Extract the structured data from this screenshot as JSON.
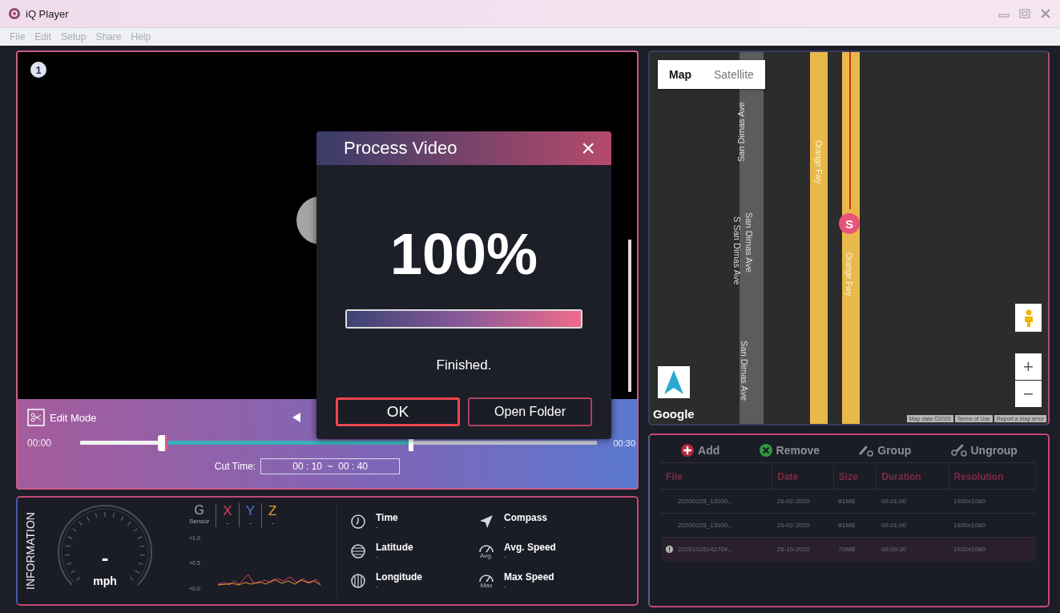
{
  "window": {
    "title": "iQ Player"
  },
  "menu": [
    {
      "label": "File",
      "disabled": true
    },
    {
      "label": "Edit",
      "disabled": true
    },
    {
      "label": "Setup",
      "disabled": true
    },
    {
      "label": "Share",
      "disabled": true
    },
    {
      "label": "Help",
      "disabled": true
    }
  ],
  "video": {
    "channel_badge": "1",
    "edit_mode": "Edit Mode",
    "start_time": "00:00",
    "end_time": "00:30",
    "playhead": {
      "level": 0.16
    },
    "cut_end": {
      "level": 0.64
    },
    "cut_time_label": "Cut Time:",
    "cut_time": "00 : 10  ~  00 : 40"
  },
  "dialog": {
    "title": "Process Video",
    "close": "×",
    "percent": "100%",
    "progress": {
      "level": 1.0
    },
    "status": "Finished.",
    "buttons": [
      {
        "label": "OK",
        "selected": true
      },
      {
        "label": "Open Folder",
        "selected": false
      }
    ]
  },
  "map": {
    "tabs": [
      {
        "label": "Map",
        "selected": true
      },
      {
        "label": "Satellite",
        "selected": false
      }
    ],
    "street_labels": [
      {
        "text": "San Dimas Ave",
        "kind": "up"
      },
      {
        "text": "San Dimas Ave",
        "kind": "down"
      },
      {
        "text": "S San Dimas Ave",
        "kind": "down"
      },
      {
        "text": "San Dimas Ave",
        "kind": "down"
      },
      {
        "text": "Orange Fwy",
        "kind": "down"
      },
      {
        "text": "Orange Fwy",
        "kind": "down"
      }
    ],
    "marker": "S",
    "zoom_in": "+",
    "zoom_out": "−",
    "logo": "Google",
    "attribution": [
      "Map data ©2020",
      "Terms of Use",
      "Report a map error"
    ]
  },
  "information": {
    "title": "INFORMATION",
    "speed": "-",
    "speed_unit": "mph",
    "g_sensor": {
      "label": "G",
      "sublabel": "Sensor",
      "axes": [
        {
          "name": "X",
          "value": "-",
          "color": "#e0445f"
        },
        {
          "name": "Y",
          "value": "-",
          "color": "#4a78d0"
        },
        {
          "name": "Z",
          "value": "-",
          "color": "#e79a35"
        }
      ],
      "scale": [
        "+1.0",
        "+0.5",
        "+0.0"
      ]
    },
    "items": [
      {
        "label": "Time",
        "value": "-",
        "kind": "clock"
      },
      {
        "label": "Compass",
        "value": "-",
        "kind": "compass"
      },
      {
        "label": "Latitude",
        "value": "-",
        "kind": "globe"
      },
      {
        "label": "Avg. Speed",
        "value": "-",
        "kind": "gauge",
        "caption": "Avg."
      },
      {
        "label": "Longitude",
        "value": "-",
        "kind": "meridian"
      },
      {
        "label": "Max Speed",
        "value": "-",
        "kind": "gauge",
        "caption": "Max"
      }
    ]
  },
  "files": {
    "toolbar": [
      {
        "label": "Add",
        "kind": "add"
      },
      {
        "label": "Remove",
        "kind": "remove"
      },
      {
        "label": "Group",
        "kind": "group"
      },
      {
        "label": "Ungroup",
        "kind": "ungroup"
      }
    ],
    "columns": [
      "File",
      "Date",
      "Size",
      "Duration",
      "Resolution"
    ],
    "rows": [
      {
        "cells": [
          "20200225_13000...",
          "26-02-2020",
          "81MB",
          "00:01:00",
          "1920x1080"
        ],
        "selected": false,
        "warning": false
      },
      {
        "cells": [
          "20200225_13000...",
          "20-02-2020",
          "81MB",
          "00:01:00",
          "1920x1080"
        ],
        "selected": false,
        "warning": false
      },
      {
        "cells": [
          "20201026142704...",
          "26-10-2020",
          "70MB",
          "00:00:30",
          "1920x1080"
        ],
        "selected": true,
        "warning": true
      }
    ]
  }
}
